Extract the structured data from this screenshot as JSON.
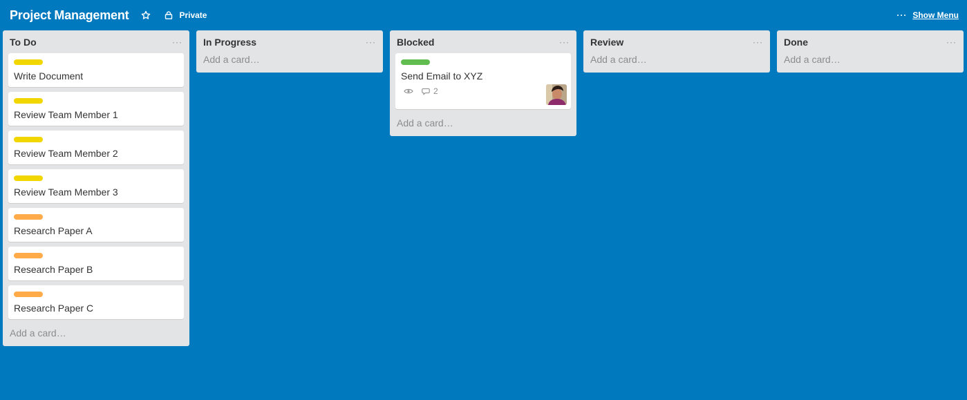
{
  "board": {
    "title": "Project Management",
    "visibility": "Private",
    "menu_label": "Show Menu",
    "menu_dots": "···",
    "background_color": "#0079bf"
  },
  "lists": [
    {
      "title": "To Do",
      "menu": "···",
      "add_label": "Add a card…",
      "cards": [
        {
          "title": "Write Document",
          "label_color": "#f2d600"
        },
        {
          "title": "Review Team Member 1",
          "label_color": "#f2d600"
        },
        {
          "title": "Review Team Member 2",
          "label_color": "#f2d600"
        },
        {
          "title": "Review Team Member 3",
          "label_color": "#f2d600"
        },
        {
          "title": "Research Paper A",
          "label_color": "#ffab4a"
        },
        {
          "title": "Research Paper B",
          "label_color": "#ffab4a"
        },
        {
          "title": "Research Paper C",
          "label_color": "#ffab4a"
        }
      ]
    },
    {
      "title": "In Progress",
      "menu": "···",
      "add_label": "Add a card…",
      "cards": []
    },
    {
      "title": "Blocked",
      "menu": "···",
      "add_label": "Add a card…",
      "cards": [
        {
          "title": "Send Email to XYZ",
          "label_color": "#61bd4f",
          "watch_icon": "eye-icon",
          "comment_count": "2",
          "member_icon": "avatar"
        }
      ]
    },
    {
      "title": "Review",
      "menu": "···",
      "add_label": "Add a card…",
      "cards": []
    },
    {
      "title": "Done",
      "menu": "···",
      "add_label": "Add a card…",
      "cards": []
    }
  ]
}
